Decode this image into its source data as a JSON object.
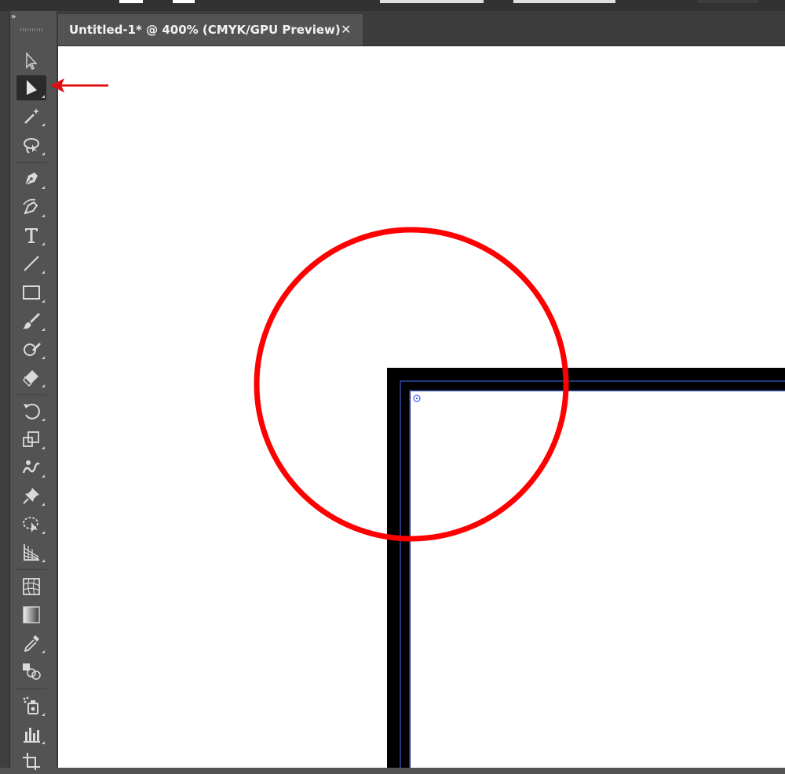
{
  "document": {
    "tab_title": "Untitled-1* @ 400% (CMYK/GPU Preview)",
    "close_glyph": "✕"
  },
  "toolbar": {
    "collapse_glyph": "»",
    "tools": [
      {
        "name": "selection-tool",
        "icon": "selection-arrow-icon",
        "active": false
      },
      {
        "name": "direct-selection-tool",
        "icon": "direct-selection-arrow-icon",
        "active": true
      },
      {
        "name": "magic-wand-tool",
        "icon": "magic-wand-icon",
        "active": false
      },
      {
        "name": "lasso-tool",
        "icon": "lasso-icon",
        "active": false
      },
      {
        "name": "pen-tool",
        "icon": "pen-icon",
        "active": false
      },
      {
        "name": "curvature-tool",
        "icon": "curvature-pen-icon",
        "active": false
      },
      {
        "name": "type-tool",
        "icon": "type-icon",
        "active": false
      },
      {
        "name": "line-segment-tool",
        "icon": "line-segment-icon",
        "active": false
      },
      {
        "name": "rectangle-tool",
        "icon": "rectangle-icon",
        "active": false
      },
      {
        "name": "paintbrush-tool",
        "icon": "paintbrush-icon",
        "active": false
      },
      {
        "name": "shaper-tool",
        "icon": "shaper-icon",
        "active": false
      },
      {
        "name": "eraser-tool",
        "icon": "eraser-icon",
        "active": false
      },
      {
        "name": "rotate-tool",
        "icon": "rotate-icon",
        "active": false
      },
      {
        "name": "scale-tool",
        "icon": "scale-icon",
        "active": false
      },
      {
        "name": "warp-tool",
        "icon": "warp-icon",
        "active": false
      },
      {
        "name": "puppet-warp-tool",
        "icon": "pushpin-icon",
        "active": false
      },
      {
        "name": "free-transform-tool",
        "icon": "free-transform-icon",
        "active": false
      },
      {
        "name": "perspective-grid-tool",
        "icon": "perspective-grid-icon",
        "active": false
      },
      {
        "name": "mesh-tool",
        "icon": "mesh-icon",
        "active": false
      },
      {
        "name": "gradient-tool",
        "icon": "gradient-icon",
        "active": false
      },
      {
        "name": "eyedropper-tool",
        "icon": "eyedropper-icon",
        "active": false
      },
      {
        "name": "blend-tool",
        "icon": "blend-icon",
        "active": false
      },
      {
        "name": "symbol-sprayer-tool",
        "icon": "symbol-sprayer-icon",
        "active": false
      },
      {
        "name": "column-graph-tool",
        "icon": "column-graph-icon",
        "active": false
      },
      {
        "name": "artboard-tool",
        "icon": "artboard-icon",
        "active": false
      }
    ]
  },
  "colors": {
    "ui_dark": "#323232",
    "ui_panel": "#535353",
    "canvas": "#ffffff",
    "stroke": "#000000",
    "selection_path": "#4a6cf7",
    "annotation": "#ff0000"
  }
}
